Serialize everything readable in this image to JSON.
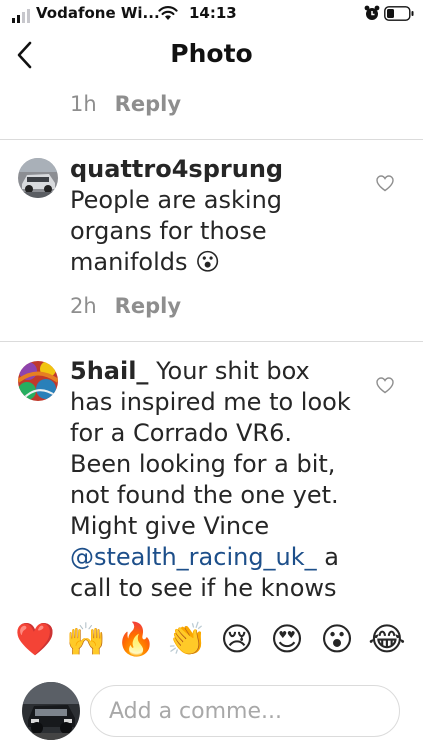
{
  "status_bar": {
    "carrier": "Vodafone Wi...",
    "time": "14:13",
    "icons": [
      "signal-icon",
      "wifi-icon",
      "alarm-icon",
      "battery-icon"
    ]
  },
  "header": {
    "title": "Photo",
    "back_icon": "chevron-left-icon"
  },
  "previous_comment_meta": {
    "time": "1h",
    "reply": "Reply"
  },
  "comments": [
    {
      "username": "quattro4sprung",
      "text_lines": [
        "People are asking",
        "organs for those",
        "manifolds 😮"
      ],
      "time": "2h",
      "reply": "Reply",
      "like_icon": "heart-outline-icon"
    },
    {
      "username": "5hail_",
      "text_first": " Your shit box",
      "text_lines": [
        "has inspired me to look",
        "for a Corrado VR6.",
        "Been looking for a bit,",
        "not found the one yet.",
        "Might give Vince"
      ],
      "mention": "@stealth_racing_uk_",
      "text_after_mention": " a",
      "text_last": "call to see if he knows",
      "like_icon": "heart-outline-icon"
    }
  ],
  "emoji_bar": [
    "❤️",
    "🙌",
    "🔥",
    "👏",
    "😢",
    "😍",
    "😮",
    "😂"
  ],
  "composer": {
    "placeholder": "Add a comme..."
  },
  "colors": {
    "text": "#262626",
    "secondary": "#8e8e8e",
    "mention": "#1d4f8a",
    "divider": "#dbdbdb"
  }
}
